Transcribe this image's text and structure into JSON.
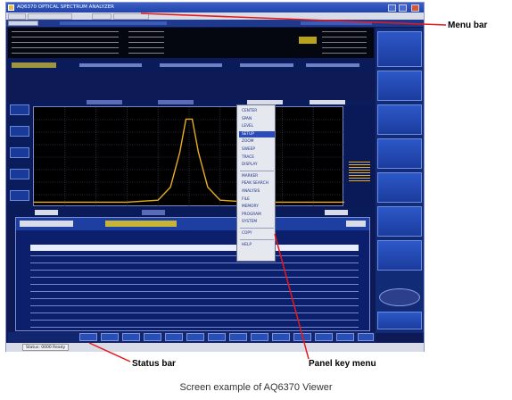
{
  "annotations": {
    "menu_bar": "Menu bar",
    "status_bar": "Status bar",
    "panel_key_menu": "Panel key menu"
  },
  "caption": "Screen example of AQ6370 Viewer",
  "window": {
    "title": "AQ6370 OPTICAL SPECTRUM ANALYZER"
  },
  "status_bar": {
    "text": "Status: 0000 Ready"
  },
  "panel_menu": {
    "items": [
      "CENTER",
      "SPAN",
      "LEVEL",
      "SETUP",
      "ZOOM",
      "SWEEP",
      "TRACE",
      "DISPLAY",
      "MARKER",
      "PEAK SEARCH",
      "ANALYSIS",
      "FILE",
      "MEMORY",
      "PROGRAM",
      "SYSTEM",
      "COPY",
      "HELP"
    ],
    "selected_index": 3
  },
  "colors": {
    "trace": "#e8b020",
    "screen_bg": "#0d1a55",
    "softkey": "#2d58c8",
    "marker_highlight": "#b9a21a"
  },
  "chart_data": {
    "type": "line",
    "series": [
      {
        "x": [
          0,
          0.3,
          0.4,
          0.44,
          0.47,
          0.49,
          0.51,
          0.53,
          0.56,
          0.6,
          0.7,
          1.0
        ],
        "y": [
          0.05,
          0.05,
          0.07,
          0.2,
          0.55,
          0.88,
          0.88,
          0.55,
          0.2,
          0.07,
          0.05,
          0.05
        ]
      }
    ],
    "grid": true
  }
}
